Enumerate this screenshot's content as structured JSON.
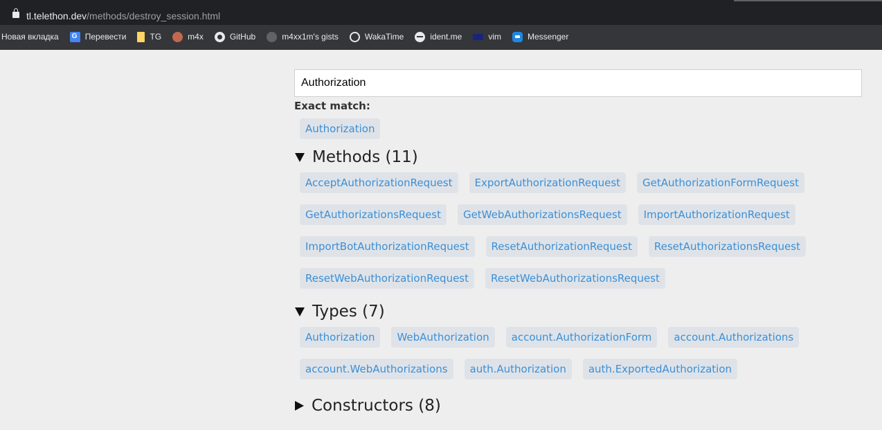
{
  "browser": {
    "url_host": "tl.telethon.dev",
    "url_path": "/methods/destroy_session.html",
    "bookmarks": [
      {
        "label": "Новая вкладка",
        "icon": "none"
      },
      {
        "label": "Перевести",
        "icon": "translate-icon"
      },
      {
        "label": "TG",
        "icon": "folder-icon"
      },
      {
        "label": "m4x",
        "icon": "avatar-icon"
      },
      {
        "label": "GitHub",
        "icon": "github-icon"
      },
      {
        "label": "m4xx1m's gists",
        "icon": "github-gist-icon"
      },
      {
        "label": "WakaTime",
        "icon": "wakatime-icon"
      },
      {
        "label": "ident.me",
        "icon": "globe-icon"
      },
      {
        "label": "vim",
        "icon": "vim-icon"
      },
      {
        "label": "Messenger",
        "icon": "messenger-icon"
      }
    ]
  },
  "search": {
    "value": "Authorization"
  },
  "exact_match": {
    "label": "Exact match:",
    "items": [
      "Authorization"
    ]
  },
  "methods": {
    "title": "Methods (11)",
    "expanded": true,
    "items": [
      "AcceptAuthorizationRequest",
      "ExportAuthorizationRequest",
      "GetAuthorizationFormRequest",
      "GetAuthorizationsRequest",
      "GetWebAuthorizationsRequest",
      "ImportAuthorizationRequest",
      "ImportBotAuthorizationRequest",
      "ResetAuthorizationRequest",
      "ResetAuthorizationsRequest",
      "ResetWebAuthorizationRequest",
      "ResetWebAuthorizationsRequest"
    ]
  },
  "types": {
    "title": "Types (7)",
    "expanded": true,
    "items": [
      "Authorization",
      "WebAuthorization",
      "account.AuthorizationForm",
      "account.Authorizations",
      "account.WebAuthorizations",
      "auth.Authorization",
      "auth.ExportedAuthorization"
    ]
  },
  "constructors": {
    "title": "Constructors (8)",
    "expanded": false
  },
  "colors": {
    "page_bg": "#eeeeee",
    "chip_bg": "#dfe3e8",
    "link": "#3b8fd6",
    "chrome_bg": "#35363a"
  }
}
